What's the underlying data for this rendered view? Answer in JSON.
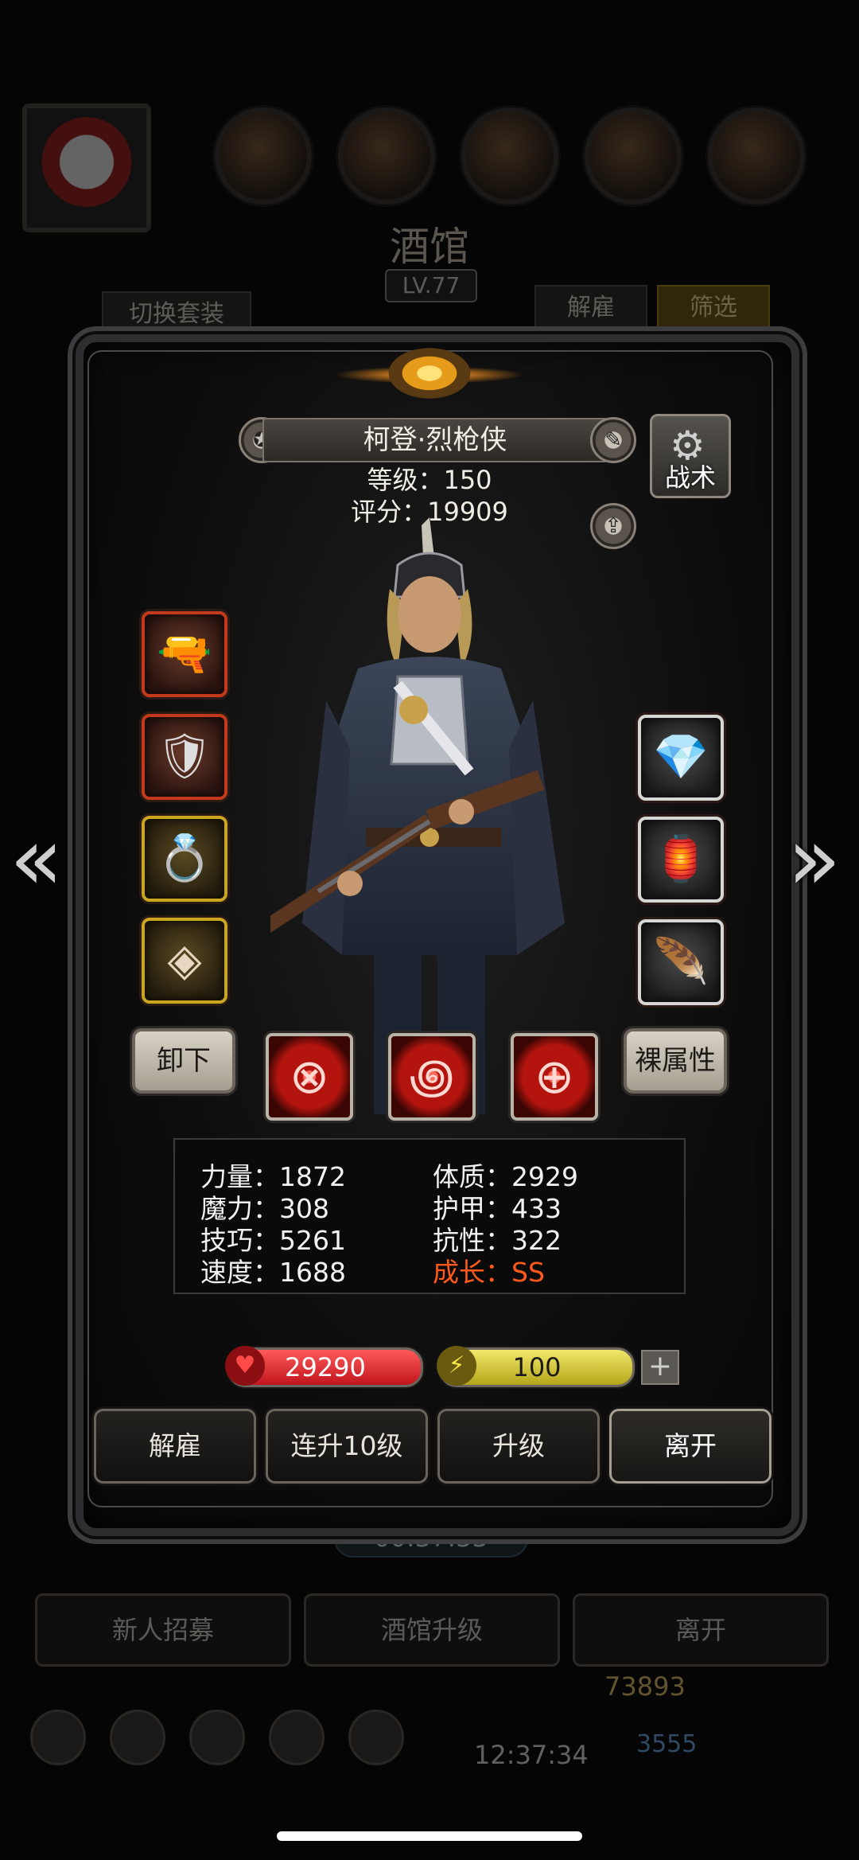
{
  "background": {
    "title": "酒馆",
    "level": "LV.77",
    "switch_outfit_label": "切换套装",
    "dismiss_label": "解雇",
    "filter_label": "筛选",
    "timer": "00:37:33",
    "buttons": [
      "新人招募",
      "酒馆升级",
      "离开"
    ],
    "gold": "73893",
    "gems": "3555",
    "clock": "12:37:34"
  },
  "hero": {
    "name": "柯登·烈枪侠",
    "level_text": "等级：150",
    "score_text": "评分：19909",
    "tactics_label": "战术"
  },
  "equipment": {
    "left": [
      {
        "name": "pistol",
        "icon": "🔫",
        "rarity": "red"
      },
      {
        "name": "armor",
        "icon": "🛡",
        "rarity": "red"
      },
      {
        "name": "necklace",
        "icon": "💍",
        "rarity": "gold"
      },
      {
        "name": "tile",
        "icon": "◈",
        "rarity": "gold"
      }
    ],
    "right": [
      {
        "name": "gem-stone",
        "icon": "💎",
        "rarity": "silver"
      },
      {
        "name": "lantern",
        "icon": "🏮",
        "rarity": "silver"
      },
      {
        "name": "wing",
        "icon": "🪶",
        "rarity": "silver"
      }
    ]
  },
  "actions": {
    "unequip_label": "卸下",
    "naked_stats_label": "裸属性"
  },
  "attributes": {
    "strength": "力量：1872",
    "magic": "魔力：308",
    "skill": "技巧：5261",
    "speed": "速度：1688",
    "constitution": "体质：2929",
    "armor": "护甲：433",
    "resistance": "抗性：322",
    "growth": "成长：SS"
  },
  "bars": {
    "hp": "29290",
    "energy": "100",
    "plus": "+"
  },
  "buttons": {
    "dismiss": "解雇",
    "upgrade10": "连升10级",
    "upgrade": "升级",
    "leave": "离开"
  },
  "colors": {
    "growth": "#ff5a1c",
    "hp_bar": "#d41a22",
    "energy_bar": "#d8ca2a"
  }
}
